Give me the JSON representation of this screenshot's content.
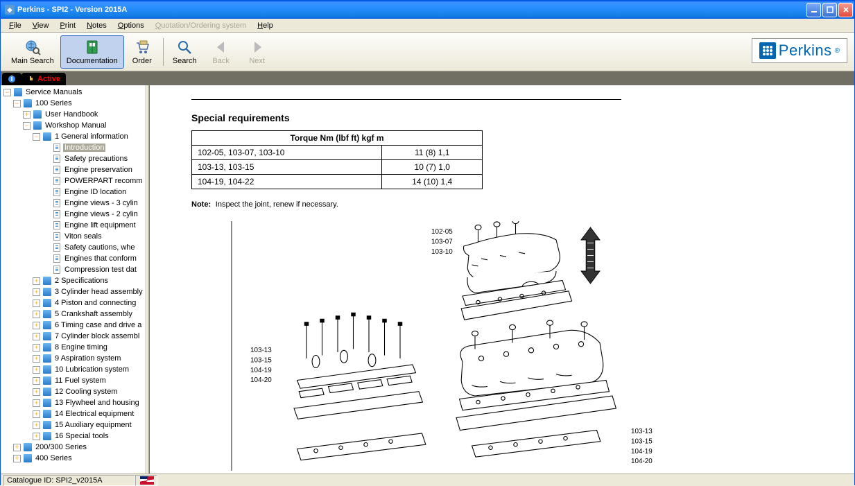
{
  "title": "Perkins - SPI2  - Version 2015A",
  "menus": [
    "File",
    "View",
    "Print",
    "Notes",
    "Options",
    "Quotation/Ordering system",
    "Help"
  ],
  "menu_disabled_index": 5,
  "toolbar": [
    {
      "id": "main-search",
      "label": "Main Search",
      "icon": "search-globe"
    },
    {
      "id": "documentation",
      "label": "Documentation",
      "icon": "book",
      "active": true
    },
    {
      "id": "order",
      "label": "Order",
      "icon": "cart"
    },
    {
      "sep": true
    },
    {
      "id": "search",
      "label": "Search",
      "icon": "magnifier"
    },
    {
      "id": "back",
      "label": "Back",
      "icon": "arrow-left",
      "disabled": true
    },
    {
      "id": "next",
      "label": "Next",
      "icon": "arrow-right",
      "disabled": true
    }
  ],
  "brand": "Perkins",
  "tabs": [
    {
      "label": "",
      "icon": "info"
    },
    {
      "label": "Active",
      "icon": "hand"
    }
  ],
  "tree": [
    {
      "d": 0,
      "exp": "minus",
      "ico": "book",
      "t": "Service Manuals"
    },
    {
      "d": 1,
      "exp": "minus",
      "ico": "book",
      "t": "100 Series"
    },
    {
      "d": 2,
      "exp": "plus",
      "ico": "closed",
      "t": "User Handbook"
    },
    {
      "d": 2,
      "exp": "minus",
      "ico": "closed",
      "t": "Workshop Manual"
    },
    {
      "d": 3,
      "exp": "minus",
      "ico": "closed",
      "t": "1 General information"
    },
    {
      "d": 4,
      "ico": "doc",
      "t": "Introduction",
      "sel": true
    },
    {
      "d": 4,
      "ico": "doc",
      "t": "Safety precautions"
    },
    {
      "d": 4,
      "ico": "doc",
      "t": "Engine preservation"
    },
    {
      "d": 4,
      "ico": "doc",
      "t": "POWERPART recomm"
    },
    {
      "d": 4,
      "ico": "doc",
      "t": "Engine ID location"
    },
    {
      "d": 4,
      "ico": "doc",
      "t": "Engine views - 3 cylin"
    },
    {
      "d": 4,
      "ico": "doc",
      "t": "Engine views - 2 cylin"
    },
    {
      "d": 4,
      "ico": "doc",
      "t": "Engine lift equipment"
    },
    {
      "d": 4,
      "ico": "doc",
      "t": "Viton seals"
    },
    {
      "d": 4,
      "ico": "doc",
      "t": "Safety cautions, whe"
    },
    {
      "d": 4,
      "ico": "doc",
      "t": "Engines that conform"
    },
    {
      "d": 4,
      "ico": "doc",
      "t": "Compression test dat"
    },
    {
      "d": 3,
      "exp": "plus",
      "ico": "closed",
      "t": "2 Specifications"
    },
    {
      "d": 3,
      "exp": "plus",
      "ico": "closed",
      "t": "3 Cylinder head assembly"
    },
    {
      "d": 3,
      "exp": "plus",
      "ico": "closed",
      "t": "4 Piston and connecting"
    },
    {
      "d": 3,
      "exp": "plus",
      "ico": "closed",
      "t": "5 Crankshaft assembly"
    },
    {
      "d": 3,
      "exp": "plus",
      "ico": "closed",
      "t": "6 Timing case and drive a"
    },
    {
      "d": 3,
      "exp": "plus",
      "ico": "closed",
      "t": "7 Cylinder block assembl"
    },
    {
      "d": 3,
      "exp": "plus",
      "ico": "closed",
      "t": "8 Engine timing"
    },
    {
      "d": 3,
      "exp": "plus",
      "ico": "closed",
      "t": "9 Aspiration system"
    },
    {
      "d": 3,
      "exp": "plus",
      "ico": "closed",
      "t": "10 Lubrication system"
    },
    {
      "d": 3,
      "exp": "plus",
      "ico": "closed",
      "t": "11 Fuel system"
    },
    {
      "d": 3,
      "exp": "plus",
      "ico": "closed",
      "t": "12 Cooling system"
    },
    {
      "d": 3,
      "exp": "plus",
      "ico": "closed",
      "t": "13 Flywheel and housing"
    },
    {
      "d": 3,
      "exp": "plus",
      "ico": "closed",
      "t": "14 Electrical equipment"
    },
    {
      "d": 3,
      "exp": "plus",
      "ico": "closed",
      "t": "15 Auxiliary equipment"
    },
    {
      "d": 3,
      "exp": "plus",
      "ico": "closed",
      "t": "16 Special tools"
    },
    {
      "d": 1,
      "exp": "plus",
      "ico": "book",
      "t": "200/300 Series"
    },
    {
      "d": 1,
      "exp": "plus",
      "ico": "book",
      "t": "400 Series"
    }
  ],
  "doc": {
    "heading": "Special requirements",
    "table_header": "Torque Nm (lbf ft) kgf m",
    "rows": [
      [
        "102-05, 103-07, 103-10",
        "11 (8) 1,1"
      ],
      [
        "103-13, 103-15",
        "10 (7) 1,0"
      ],
      [
        "104-19, 104-22",
        "14 (10) 1,4"
      ]
    ],
    "note_label": "Note:",
    "note_text": "Inspect the joint, renew if necessary.",
    "callouts_top": [
      "102-05",
      "103-07",
      "103-10"
    ],
    "callouts_mid": [
      "103-13",
      "103-15",
      "104-19",
      "104-20"
    ],
    "callouts_right": [
      "103-13",
      "103-15",
      "104-19",
      "104-20"
    ]
  },
  "status": "Catalogue ID: SPI2_v2015A"
}
